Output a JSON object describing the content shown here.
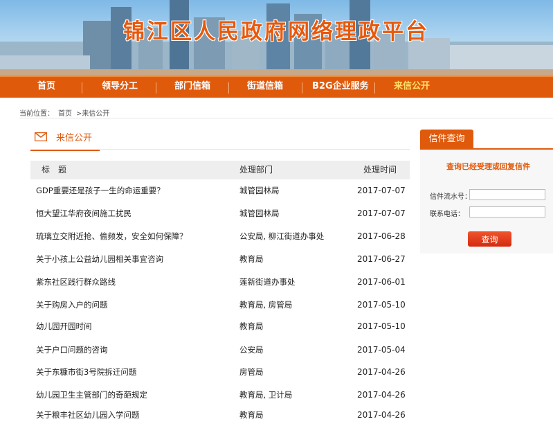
{
  "banner": {
    "title": "锦江区人民政府网络理政平台"
  },
  "nav": {
    "items": [
      {
        "label": "首页"
      },
      {
        "label": "领导分工"
      },
      {
        "label": "部门信箱"
      },
      {
        "label": "街道信箱"
      },
      {
        "label": "B2G企业服务"
      },
      {
        "label": "来信公开"
      }
    ]
  },
  "breadcrumb": {
    "prefix": "当前位置：",
    "home": "首页",
    "current": ">来信公开"
  },
  "main": {
    "title": "来信公开",
    "columns": {
      "title": "标　题",
      "dept": "处理部门",
      "date": "处理时间"
    },
    "rows": [
      {
        "title": "GDP重要还是孩子一生的命运重要？",
        "dept": "城管园林局",
        "date": "2017-07-07"
      },
      {
        "title": "恒大望江华府夜间施工扰民",
        "dept": "城管园林局",
        "date": "2017-07-07"
      },
      {
        "title": "琉璃立交附近抢、偷频发，安全如何保障？",
        "dept": "公安局, 柳江街道办事处",
        "date": "2017-06-28"
      },
      {
        "title": "关于小孩上公益幼儿园相关事宜咨询",
        "dept": "教育局",
        "date": "2017-06-27"
      },
      {
        "title": "紫东社区践行群众路线",
        "dept": "莲新街道办事处",
        "date": "2017-06-01"
      },
      {
        "title": "关于购房入户的问题",
        "dept": "教育局, 房管局",
        "date": "2017-05-10"
      },
      {
        "title": "幼儿园开园时间",
        "dept": "教育局",
        "date": "2017-05-10"
      },
      {
        "title": "关于户口问题的咨询",
        "dept": "公安局",
        "date": "2017-05-04"
      },
      {
        "title": "关于东糠市街3号院拆迁问题",
        "dept": "房管局",
        "date": "2017-04-26"
      },
      {
        "title": "幼儿园卫生主管部门的奇葩规定",
        "dept": "教育局, 卫计局",
        "date": "2017-04-26"
      },
      {
        "title": "关于粮丰社区幼儿园入学问题",
        "dept": "教育局",
        "date": "2017-04-26"
      }
    ]
  },
  "sidebar": {
    "title": "信件查询",
    "subtitle": "查询已经受理或回复信件",
    "serial_label": "信件流水号：",
    "phone_label": "联系电话：",
    "serial_value": "",
    "phone_value": "",
    "button": "查询"
  },
  "colors": {
    "accent": "#e05a0c",
    "nav_active": "#ffe066",
    "button": "#d32a10"
  }
}
